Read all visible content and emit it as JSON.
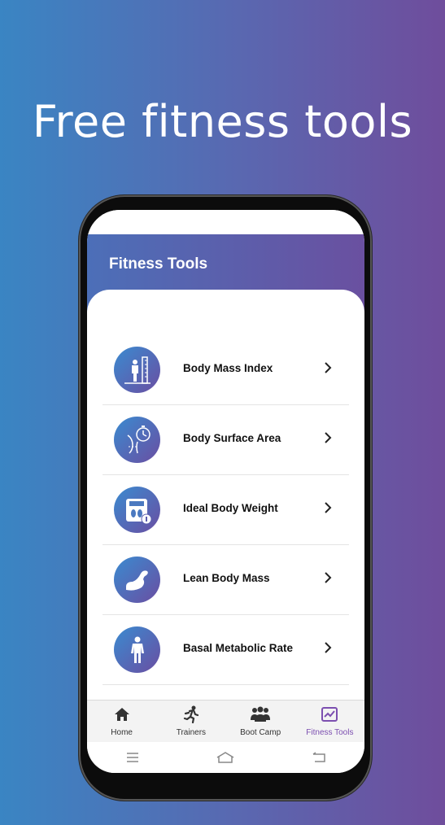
{
  "promo": {
    "headline": "Free fitness tools"
  },
  "app": {
    "title": "Fitness Tools"
  },
  "tools": [
    {
      "label": "Body Mass Index",
      "icon": "height-scale-icon"
    },
    {
      "label": "Body Surface Area",
      "icon": "body-stopwatch-icon"
    },
    {
      "label": "Ideal Body Weight",
      "icon": "weight-scale-icon"
    },
    {
      "label": "Lean Body Mass",
      "icon": "flexed-arm-icon"
    },
    {
      "label": "Basal Metabolic Rate",
      "icon": "human-body-icon"
    }
  ],
  "nav": {
    "items": [
      {
        "label": "Home",
        "icon": "home-icon"
      },
      {
        "label": "Trainers",
        "icon": "runner-icon"
      },
      {
        "label": "Boot Camp",
        "icon": "group-icon"
      },
      {
        "label": "Fitness Tools",
        "icon": "chart-icon",
        "active": true
      }
    ]
  },
  "colors": {
    "accent": "#7c4fb0",
    "header_start": "#4c6fb8",
    "header_end": "#6a50a0"
  }
}
